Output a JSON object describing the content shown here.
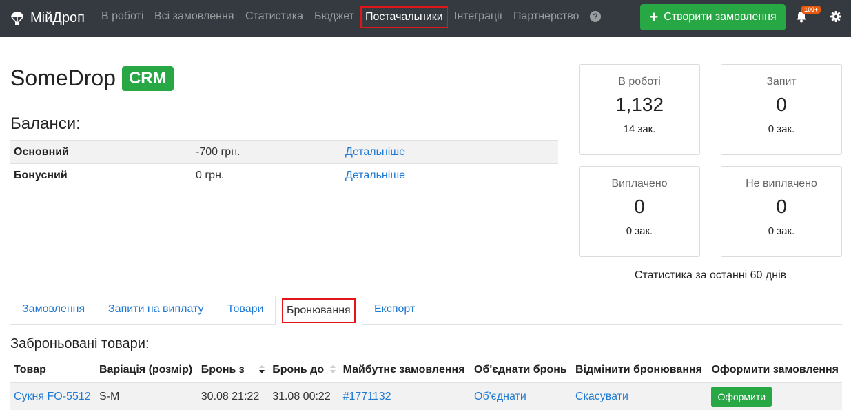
{
  "navbar": {
    "brand": "МійДроп",
    "items": [
      {
        "label": "В роботі"
      },
      {
        "label": "Всі замовлення"
      },
      {
        "label": "Статистика"
      },
      {
        "label": "Бюджет"
      },
      {
        "label": "Постачальники"
      },
      {
        "label": "Інтеграції"
      },
      {
        "label": "Партнерство"
      }
    ],
    "help_glyph": "?",
    "create_button": "Створити замовлення",
    "notification_badge": "100+",
    "icons": [
      "parachute-icon",
      "help-icon",
      "plus-icon",
      "bell-icon",
      "gear-icon"
    ]
  },
  "header": {
    "title": "SomeDrop",
    "badge": "CRM"
  },
  "balances": {
    "heading": "Баланси:",
    "rows": [
      {
        "name": "Основний",
        "amount": "-700 грн.",
        "link": "Детальніше"
      },
      {
        "name": "Бонусний",
        "amount": "0 грн.",
        "link": "Детальніше"
      }
    ]
  },
  "stats": {
    "cards": [
      {
        "label": "В роботі",
        "value": "1,132",
        "sub": "14 зак."
      },
      {
        "label": "Запит",
        "value": "0",
        "sub": "0 зак."
      },
      {
        "label": "Виплачено",
        "value": "0",
        "sub": "0 зак."
      },
      {
        "label": "Не виплачено",
        "value": "0",
        "sub": "0 зак."
      }
    ],
    "note": "Статистика за останні 60 днів"
  },
  "tabs": [
    {
      "label": "Замовлення"
    },
    {
      "label": "Запити на виплату"
    },
    {
      "label": "Товари"
    },
    {
      "label": "Бронювання"
    },
    {
      "label": "Експорт"
    }
  ],
  "reservations": {
    "heading": "Заброньовані товари:",
    "columns": [
      "Товар",
      "Варіація (розмір)",
      "Бронь з",
      "Бронь до",
      "Майбутнє замовлення",
      "Об'єднати бронь",
      "Відмінити бронювання",
      "Оформити замовлення"
    ],
    "rows": [
      {
        "product": "Сукня FO-5512",
        "variation": "S-M",
        "from": "30.08 21:22",
        "to": "31.08 00:22",
        "future_order": "#1771132",
        "merge": "Об'єднати",
        "cancel": "Скасувати",
        "checkout": "Оформити"
      }
    ]
  },
  "colors": {
    "navbar_bg": "#343a40",
    "accent_green": "#28a745",
    "link_blue": "#1f7ad3",
    "highlight_red": "#e0161b",
    "badge_orange": "#e8590c"
  }
}
